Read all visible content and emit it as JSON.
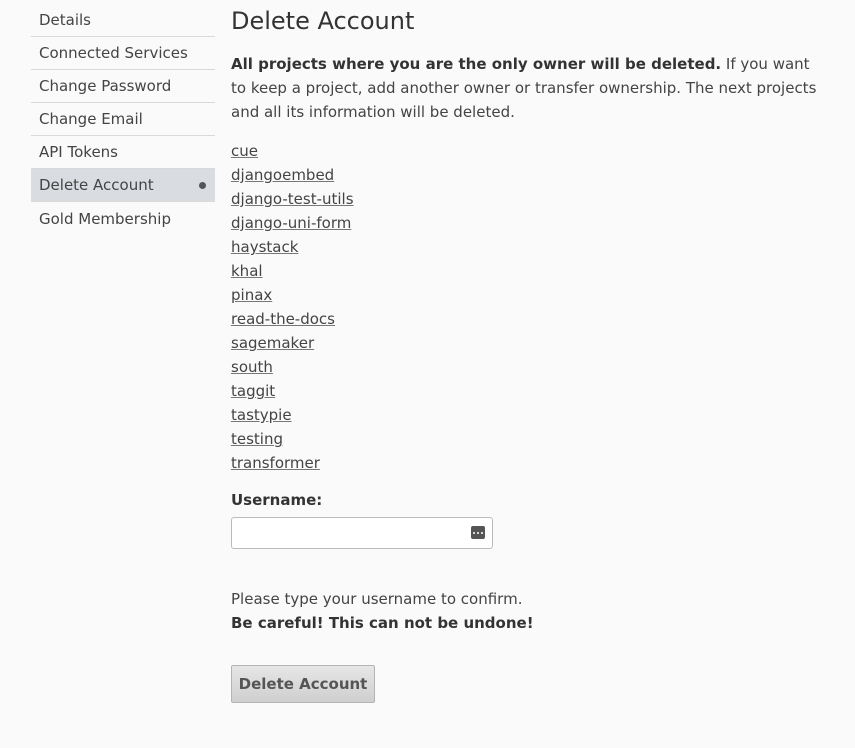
{
  "sidebar": {
    "items": [
      {
        "label": "Details"
      },
      {
        "label": "Connected Services"
      },
      {
        "label": "Change Password"
      },
      {
        "label": "Change Email"
      },
      {
        "label": "API Tokens"
      },
      {
        "label": "Delete Account"
      },
      {
        "label": "Gold Membership"
      }
    ]
  },
  "main": {
    "title": "Delete Account",
    "intro_bold": "All projects where you are the only owner will be deleted.",
    "intro_rest": " If you want to keep a project, add another owner or transfer ownership. The next projects and all its information will be deleted.",
    "projects": [
      "cue",
      "djangoembed",
      "django-test-utils",
      "django-uni-form",
      "haystack",
      "khal",
      "pinax",
      "read-the-docs",
      "sagemaker",
      "south",
      "taggit",
      "tastypie",
      "testing",
      "transformer"
    ],
    "username_label": "Username:",
    "username_value": "",
    "help_text": "Please type your username to confirm.",
    "warning_text": "Be careful! This can not be undone!",
    "submit_label": "Delete Account"
  }
}
